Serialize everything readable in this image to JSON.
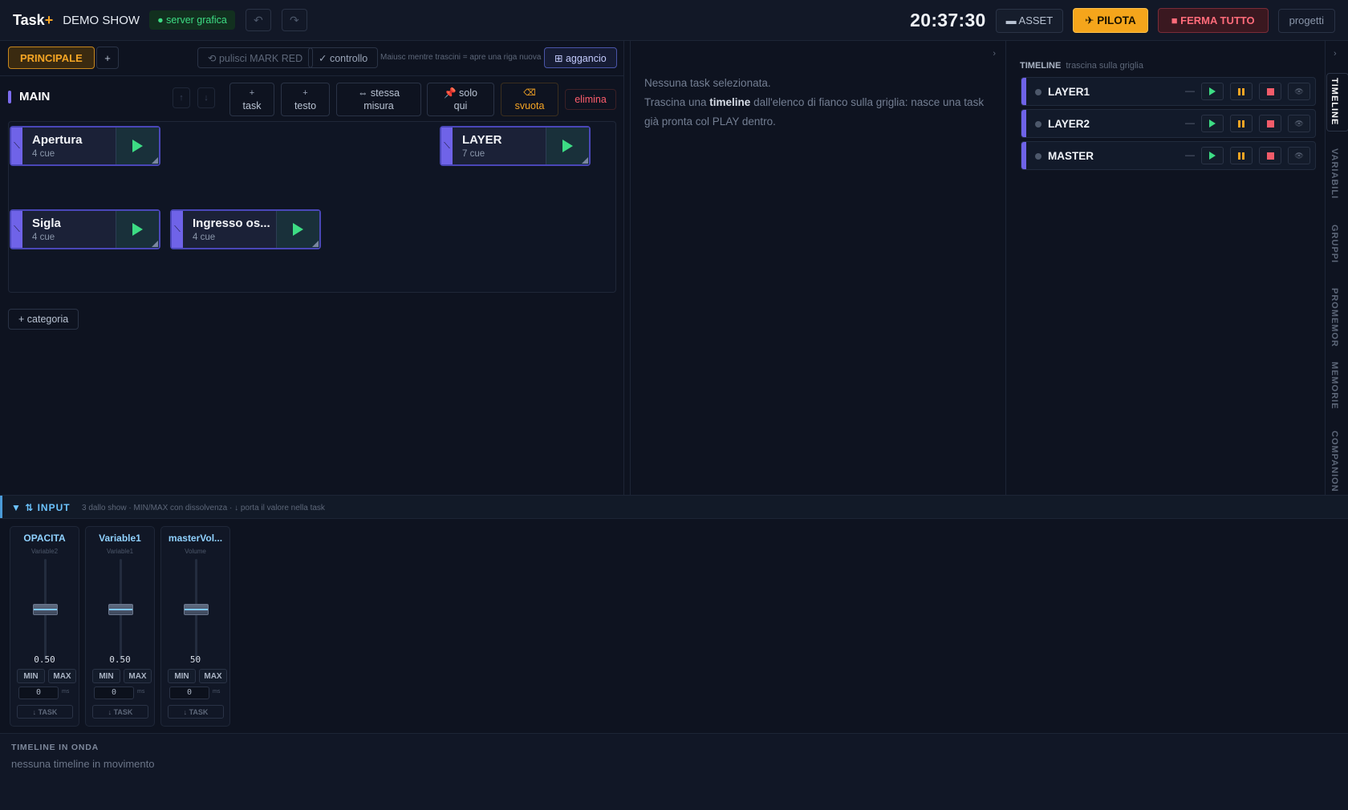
{
  "app": {
    "logo": "Task",
    "logo_plus": "+",
    "show_name": "DEMO SHOW",
    "server_badge": "● server grafica",
    "undo_icon": "↶",
    "redo_icon": "↷",
    "clock": "20:37:30",
    "asset_label": "▬ ASSET",
    "pilota_label": "✈ PILOTA",
    "ferma_label": "■ FERMA TUTTO",
    "progetti_label": "progetti"
  },
  "left": {
    "tab_main": "PRINCIPALE",
    "tab_add": "+",
    "pulisci_label": "⟲ pulisci MARK RED",
    "controllo_label": "✓ controllo",
    "hint": "Maiusc mentre trascini = apre una riga nuova",
    "aggancio_label": "⊞ aggancio",
    "category": {
      "title": "MAIN",
      "up": "↑",
      "down": "↓",
      "btn_task_top": "+",
      "btn_task_bottom": "task",
      "btn_testo_top": "+",
      "btn_testo_bottom": "testo",
      "btn_stessa_top": "⇔ stessa",
      "btn_stessa_bottom": "misura",
      "btn_solo_top": "📌 solo",
      "btn_solo_bottom": "qui",
      "btn_svuota_top": "⌫",
      "btn_svuota_bottom": "svuota",
      "btn_elimina": "elimina"
    },
    "tasks": [
      {
        "name": "Apertura",
        "cues": "4 cue"
      },
      {
        "name": "LAYER",
        "cues": "7 cue"
      },
      {
        "name": "Sigla",
        "cues": "4 cue"
      },
      {
        "name": "Ingresso os...",
        "cues": "4 cue"
      }
    ],
    "add_category": "+ categoria"
  },
  "middle": {
    "arrow": "›",
    "line1": "Nessuna task selezionata.",
    "line2_pre": "Trascina una ",
    "line2_bold": "timeline",
    "line2_post": " dall'elenco di fianco sulla griglia: nasce una task già pronta col PLAY dentro."
  },
  "right": {
    "header": "TIMELINE",
    "header_sub": "trascina sulla griglia",
    "dash": "—",
    "eye_icon": "👁",
    "layers": [
      {
        "name": "LAYER1"
      },
      {
        "name": "LAYER2"
      },
      {
        "name": "MASTER"
      }
    ]
  },
  "side_tabs": {
    "arrow": "›",
    "items": [
      "TIMELINE",
      "VARIABILI",
      "GRUPPI",
      "PROMEMOR",
      "MEMORIE",
      "COMPANION"
    ]
  },
  "input": {
    "title": "▼ ⇅ INPUT",
    "subtitle": "3 dallo show · MIN/MAX con dissolvenza · ↓ porta il valore nella task",
    "min_label": "MIN",
    "max_label": "MAX",
    "ms_unit": "ms",
    "task_label": "↓ TASK",
    "faders": [
      {
        "name": "OPACITA",
        "source": "Variable2",
        "value": "0.50",
        "ms": "0",
        "level": 0.5
      },
      {
        "name": "Variable1",
        "source": "Variable1",
        "value": "0.50",
        "ms": "0",
        "level": 0.5
      },
      {
        "name": "masterVol...",
        "source": "Volume",
        "value": "50",
        "ms": "0",
        "level": 0.5
      }
    ]
  },
  "bottom": {
    "title": "TIMELINE IN ONDA",
    "subtitle": "nessuna timeline in movimento"
  },
  "colors": {
    "accent_orange": "#f5a524",
    "play_green": "#3ddc84",
    "stop_red": "#f25c6a",
    "task_purple": "#6f63e8",
    "input_blue": "#6cc4ff"
  }
}
